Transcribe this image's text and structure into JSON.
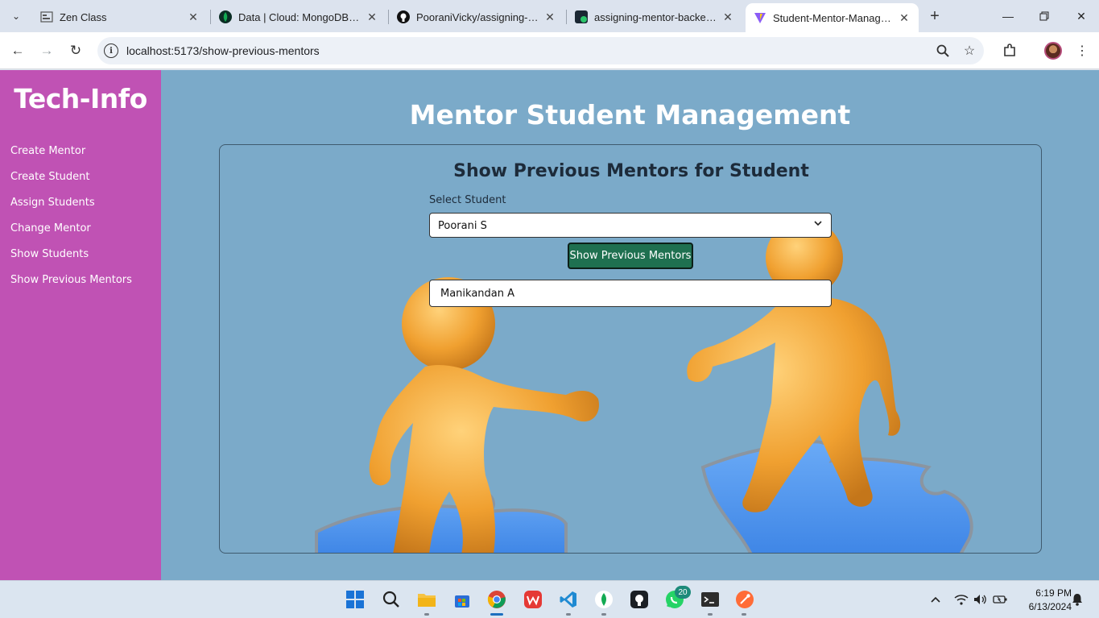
{
  "browser": {
    "tabs": [
      {
        "title": "Zen Class",
        "icon": "zen-class-favicon"
      },
      {
        "title": "Data | Cloud: MongoDB Cloud",
        "icon": "mongodb-leaf-icon"
      },
      {
        "title": "PooraniVicky/assigning-mentor",
        "icon": "github-icon"
      },
      {
        "title": "assigning-mentor-backend",
        "icon": "render-icon"
      },
      {
        "title": "Student-Mentor-Management",
        "icon": "vite-icon",
        "active": true
      }
    ],
    "url": "localhost:5173/show-previous-mentors"
  },
  "app": {
    "brand": "Tech-Info",
    "nav": [
      "Create Mentor",
      "Create Student",
      "Assign Students",
      "Change Mentor",
      "Show Students",
      "Show Previous Mentors"
    ],
    "page_title": "Mentor Student Management",
    "card": {
      "heading": "Show Previous Mentors for Student",
      "select_label": "Select Student",
      "selected_student": "Poorani S",
      "button_label": "Show Previous Mentors",
      "result": "Manikandan A"
    },
    "colors": {
      "sidebar": "#c052b4",
      "background": "#7baac9",
      "button": "#1f7050"
    }
  },
  "taskbar": {
    "apps": [
      "windows-start-icon",
      "search-icon",
      "file-explorer-icon",
      "microsoft-store-icon",
      "chrome-icon",
      "wps-office-icon",
      "vscode-icon",
      "mongodb-compass-icon",
      "github-desktop-icon",
      "whatsapp-icon",
      "terminal-icon",
      "postman-icon"
    ],
    "whatsapp_badge": "20",
    "time": "6:19 PM",
    "date": "6/13/2024"
  }
}
